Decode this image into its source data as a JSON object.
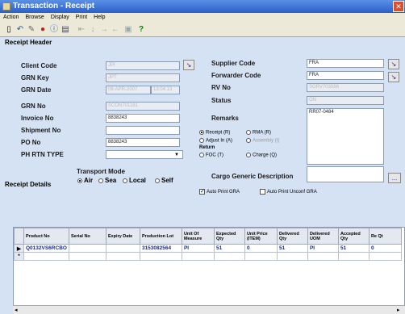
{
  "window": {
    "title": "Transaction - Receipt",
    "close_label": "✕"
  },
  "menu": [
    "Action",
    "Browse",
    "Display",
    "Print",
    "Help"
  ],
  "toolbar": {
    "icons": [
      "save-icon",
      "undo-icon",
      "delete-icon",
      "record-icon",
      "info-icon",
      "print-icon",
      "first-icon",
      "prev-icon",
      "next-icon",
      "last-icon",
      "find-icon",
      "help-icon"
    ]
  },
  "header": {
    "section_label": "Receipt Header",
    "client_code": {
      "label": "Client Code",
      "value": "JPI"
    },
    "grn_key": {
      "label": "GRN Key",
      "value": "JPT"
    },
    "grn_date": {
      "label": "GRN Date",
      "value": "08-APR-2007",
      "time": "13:04:13"
    },
    "grn_no": {
      "label": "GRN No",
      "value": "SCON701181"
    },
    "invoice_no": {
      "label": "Invoice No",
      "value": "8838243"
    },
    "shipment_no": {
      "label": "Shipment No",
      "value": ""
    },
    "po_no": {
      "label": "PO No",
      "value": "8838243"
    },
    "ph_rtn_type": {
      "label": "PH RTN TYPE",
      "value": ""
    },
    "supplier_code": {
      "label": "Supplier Code",
      "value": "FRA"
    },
    "forwarder_code": {
      "label": "Forwarder Code",
      "value": "FRA"
    },
    "rv_no": {
      "label": "RV No",
      "value": "SGRV703086"
    },
    "status": {
      "label": "Status",
      "value": "ON"
    },
    "remarks": {
      "label": "Remarks",
      "value": "RR07-0484"
    },
    "transport_mode": {
      "label": "Transport Mode",
      "options": [
        "Air",
        "Sea",
        "Local",
        "Self"
      ],
      "selected": "Air"
    },
    "receipt_types": {
      "options": [
        "Receipt (R)",
        "RMA (R)",
        "Adjust In (A)",
        "Assembly (I)"
      ],
      "selected": "Receipt (R)"
    },
    "return_label": "Return",
    "return_types": {
      "options": [
        "FOC (T)",
        "Charge (Q)"
      ]
    },
    "cargo_label": "Cargo Generic Description",
    "cargo_button": "...",
    "auto_print_gra": "Auto Print GRA",
    "auto_print_unconf": "Auto Print Unconf GRA"
  },
  "details": {
    "section_label": "Receipt Details",
    "columns": [
      "Product No",
      "Serial No",
      "Expiry Date",
      "Production Lot",
      "Unit Of Measure",
      "Expected Qty",
      "Unit Price (ITEM)",
      "Delivered Qty",
      "Delivered UOM",
      "Accepted Qty",
      "Re Qt"
    ],
    "rows": [
      [
        "Q0132VS6RCBO",
        "",
        "",
        "3153082564",
        "PI",
        "51",
        "0",
        "51",
        "PI",
        "51",
        "0"
      ],
      [
        "",
        "",
        "",
        "",
        "",
        "",
        "",
        "",
        "",
        "",
        ""
      ]
    ]
  }
}
